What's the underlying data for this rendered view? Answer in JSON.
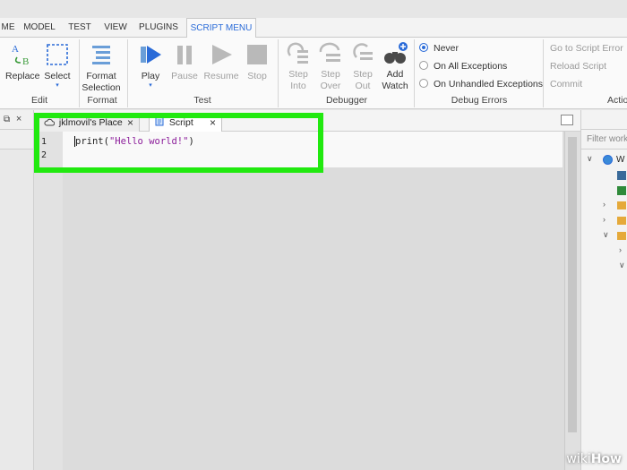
{
  "menu": {
    "tabs": [
      {
        "label": "ME"
      },
      {
        "label": "MODEL"
      },
      {
        "label": "TEST"
      },
      {
        "label": "VIEW"
      },
      {
        "label": "PLUGINS"
      },
      {
        "label": "SCRIPT MENU",
        "active": true
      }
    ]
  },
  "ribbon": {
    "edit": {
      "replace": "Replace",
      "select": "Select",
      "group": "Edit"
    },
    "format": {
      "format_selection_1": "Format",
      "format_selection_2": "Selection",
      "group": "Format"
    },
    "test": {
      "play": "Play",
      "pause": "Pause",
      "resume": "Resume",
      "stop": "Stop",
      "group": "Test"
    },
    "debugger": {
      "step_into_1": "Step",
      "step_into_2": "Into",
      "step_over_1": "Step",
      "step_over_2": "Over",
      "step_out_1": "Step",
      "step_out_2": "Out",
      "add_watch_1": "Add",
      "add_watch_2": "Watch",
      "group": "Debugger"
    },
    "debug_errors": {
      "never": "Never",
      "on_all": "On All Exceptions",
      "on_unhandled": "On Unhandled Exceptions",
      "group": "Debug Errors",
      "selected": "Never"
    },
    "actions": {
      "goto_error": "Go to Script Error",
      "reload": "Reload Script",
      "commit": "Commit",
      "group": "Actio"
    }
  },
  "doc_tabs": [
    {
      "label": "jklmovil's Place",
      "close": "×"
    },
    {
      "label": "Script",
      "close": "×",
      "active": true
    }
  ],
  "editor": {
    "line_numbers": [
      "1",
      "2"
    ],
    "code": {
      "fn": "print",
      "open": "(",
      "str": "\"Hello world!\"",
      "close": ")"
    }
  },
  "explorer": {
    "filter_placeholder": "Filter work",
    "first_item": "W"
  },
  "watermark": {
    "wiki": "wiki",
    "how": "How"
  },
  "colors": {
    "highlight": "#21e90f",
    "accent": "#2a6bd8",
    "string": "#8b1c9a"
  }
}
